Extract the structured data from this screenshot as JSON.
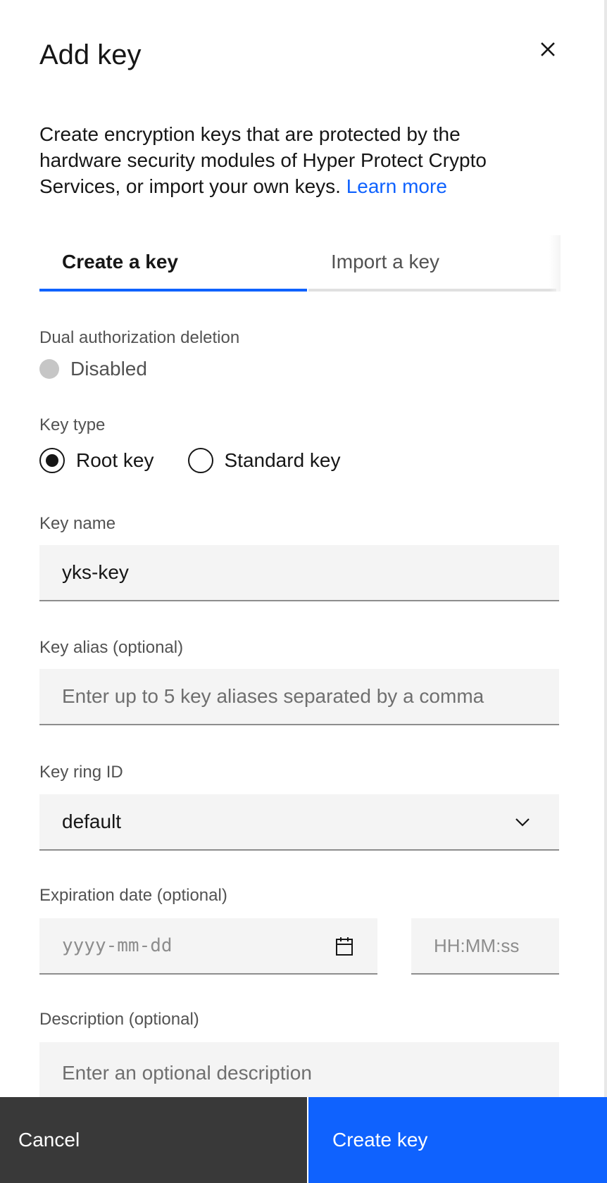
{
  "modal": {
    "title": "Add key",
    "description": "Create encryption keys that are protected by the hardware security modules of Hyper Protect Crypto Services, or import your own keys.",
    "learn_more": "Learn more"
  },
  "tabs": [
    {
      "label": "Create a key",
      "selected": true
    },
    {
      "label": "Import a key",
      "selected": false
    }
  ],
  "dual_auth": {
    "label": "Dual authorization deletion",
    "state": "Disabled"
  },
  "key_type": {
    "label": "Key type",
    "options": [
      {
        "label": "Root key",
        "selected": true
      },
      {
        "label": "Standard key",
        "selected": false
      }
    ]
  },
  "key_name": {
    "label": "Key name",
    "value": "yks-key"
  },
  "key_alias": {
    "label": "Key alias (optional)",
    "placeholder": "Enter up to 5 key aliases separated by a comma"
  },
  "key_ring": {
    "label": "Key ring ID",
    "value": "default"
  },
  "expiration": {
    "label": "Expiration date (optional)",
    "date_placeholder": "yyyy-mm-dd",
    "time_placeholder": "HH:MM:ss"
  },
  "description_field": {
    "label": "Description (optional)",
    "placeholder": "Enter an optional description"
  },
  "footer": {
    "cancel": "Cancel",
    "create": "Create key"
  },
  "colors": {
    "primary": "#0f62fe",
    "secondary_button": "#393939",
    "field_bg": "#f4f4f4"
  }
}
